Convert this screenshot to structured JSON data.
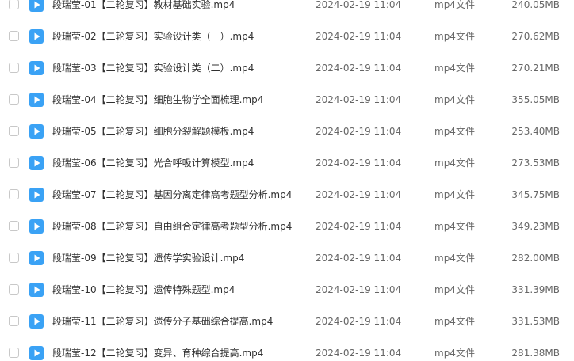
{
  "file_list": {
    "icon": "video-file-icon",
    "accent_color": "#3aa2f5",
    "rows": [
      {
        "name": "段瑞莹-01【二轮复习】教材基础实验.mp4",
        "date": "2024-02-19 11:04",
        "type": "mp4文件",
        "size": "240.05MB"
      },
      {
        "name": "段瑞莹-02【二轮复习】实验设计类（一）.mp4",
        "date": "2024-02-19 11:04",
        "type": "mp4文件",
        "size": "270.62MB"
      },
      {
        "name": "段瑞莹-03【二轮复习】实验设计类（二）.mp4",
        "date": "2024-02-19 11:04",
        "type": "mp4文件",
        "size": "270.21MB"
      },
      {
        "name": "段瑞莹-04【二轮复习】细胞生物学全面梳理.mp4",
        "date": "2024-02-19 11:04",
        "type": "mp4文件",
        "size": "355.05MB"
      },
      {
        "name": "段瑞莹-05【二轮复习】细胞分裂解题模板.mp4",
        "date": "2024-02-19 11:04",
        "type": "mp4文件",
        "size": "253.40MB"
      },
      {
        "name": "段瑞莹-06【二轮复习】光合呼吸计算模型.mp4",
        "date": "2024-02-19 11:04",
        "type": "mp4文件",
        "size": "273.53MB"
      },
      {
        "name": "段瑞莹-07【二轮复习】基因分离定律高考题型分析.mp4",
        "date": "2024-02-19 11:04",
        "type": "mp4文件",
        "size": "345.75MB"
      },
      {
        "name": "段瑞莹-08【二轮复习】自由组合定律高考题型分析.mp4",
        "date": "2024-02-19 11:04",
        "type": "mp4文件",
        "size": "349.23MB"
      },
      {
        "name": "段瑞莹-09【二轮复习】遗传学实验设计.mp4",
        "date": "2024-02-19 11:04",
        "type": "mp4文件",
        "size": "282.00MB"
      },
      {
        "name": "段瑞莹-10【二轮复习】遗传特殊题型.mp4",
        "date": "2024-02-19 11:04",
        "type": "mp4文件",
        "size": "331.39MB"
      },
      {
        "name": "段瑞莹-11【二轮复习】遗传分子基础综合提高.mp4",
        "date": "2024-02-19 11:04",
        "type": "mp4文件",
        "size": "331.53MB"
      },
      {
        "name": "段瑞莹-12【二轮复习】变异、育种综合提高.mp4",
        "date": "2024-02-19 11:04",
        "type": "mp4文件",
        "size": "281.38MB"
      }
    ]
  }
}
